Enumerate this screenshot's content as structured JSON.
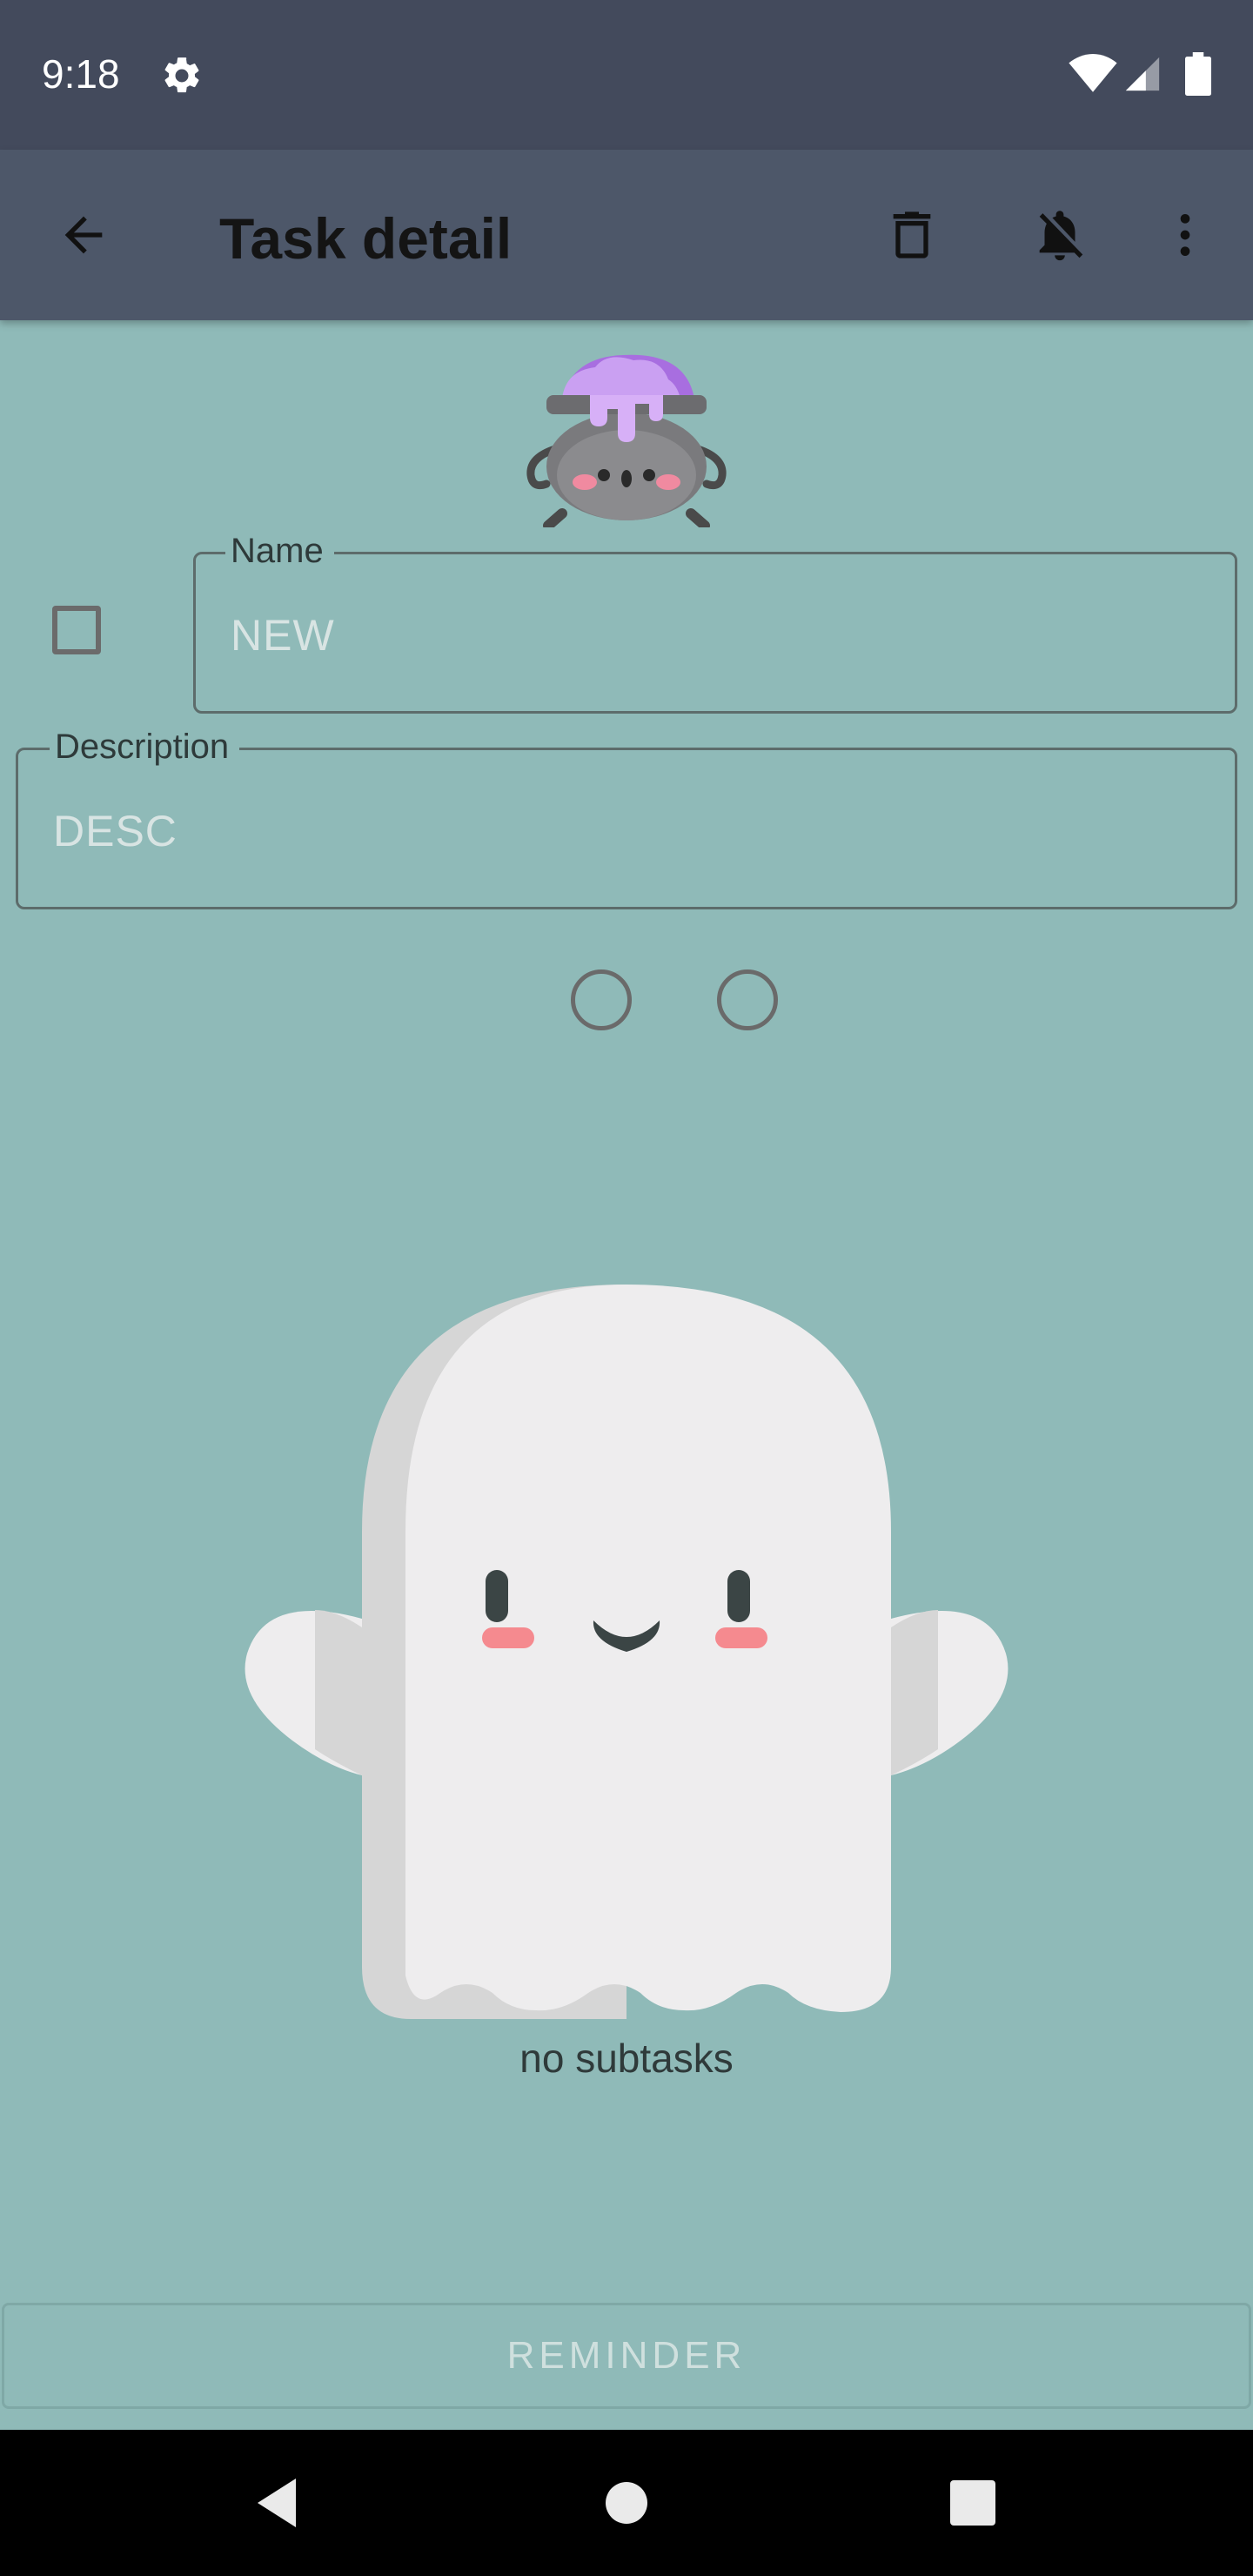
{
  "status_bar": {
    "time": "9:18",
    "icons": [
      "gear-icon",
      "wifi-icon",
      "signal-icon",
      "battery-icon"
    ]
  },
  "app_bar": {
    "title": "Task detail",
    "icons": [
      "back-arrow-icon",
      "delete-icon",
      "notifications-off-icon",
      "more-vert-icon"
    ]
  },
  "form": {
    "name_label": "Name",
    "name_value": "NEW",
    "description_label": "Description",
    "description_value": "DESC"
  },
  "subtasks": {
    "empty_text": "no subtasks"
  },
  "reminder_button": {
    "label": "REMINDER"
  },
  "nav_bar": {
    "icons": [
      "nav-back-icon",
      "nav-home-icon",
      "nav-recents-icon"
    ]
  },
  "colors": {
    "background": "#8fbab8",
    "status_bar": "#434a5c",
    "app_bar": "#4d5769",
    "navigation_bar": "#000000"
  }
}
